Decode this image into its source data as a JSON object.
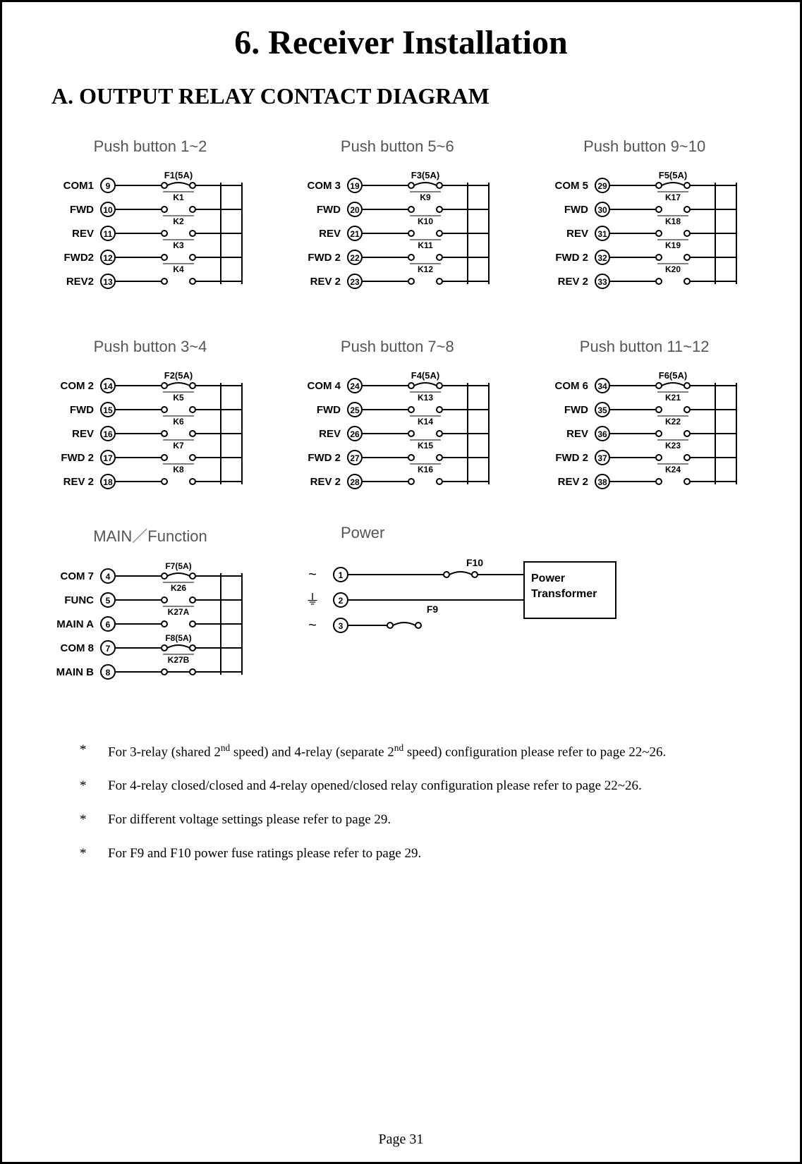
{
  "title": "6. Receiver Installation",
  "subtitle": "A. OUTPUT RELAY CONTACT DIAGRAM",
  "blocks": [
    {
      "title": "Push button 1~2",
      "fuse": "F1(5A)",
      "rows": [
        {
          "label": "COM1",
          "term": "9",
          "type": "fuse",
          "k": "K1"
        },
        {
          "label": "FWD",
          "term": "10",
          "type": "no",
          "k": "K2"
        },
        {
          "label": "REV",
          "term": "11",
          "type": "no",
          "k": "K3"
        },
        {
          "label": "FWD2",
          "term": "12",
          "type": "no",
          "k": "K4"
        },
        {
          "label": "REV2",
          "term": "13",
          "type": "no",
          "k": ""
        }
      ]
    },
    {
      "title": "Push button 5~6",
      "fuse": "F3(5A)",
      "rows": [
        {
          "label": "COM 3",
          "term": "19",
          "type": "fuse",
          "k": "K9"
        },
        {
          "label": "FWD",
          "term": "20",
          "type": "no",
          "k": "K10"
        },
        {
          "label": "REV",
          "term": "21",
          "type": "no",
          "k": "K11"
        },
        {
          "label": "FWD 2",
          "term": "22",
          "type": "no",
          "k": "K12"
        },
        {
          "label": "REV 2",
          "term": "23",
          "type": "no",
          "k": ""
        }
      ]
    },
    {
      "title": "Push button 9~10",
      "fuse": "F5(5A)",
      "rows": [
        {
          "label": "COM 5",
          "term": "29",
          "type": "fuse",
          "k": "K17"
        },
        {
          "label": "FWD",
          "term": "30",
          "type": "no",
          "k": "K18"
        },
        {
          "label": "REV",
          "term": "31",
          "type": "no",
          "k": "K19"
        },
        {
          "label": "FWD 2",
          "term": "32",
          "type": "no",
          "k": "K20"
        },
        {
          "label": "REV 2",
          "term": "33",
          "type": "no",
          "k": ""
        }
      ]
    },
    {
      "title": "Push button 3~4",
      "fuse": "F2(5A)",
      "rows": [
        {
          "label": "COM 2",
          "term": "14",
          "type": "fuse",
          "k": "K5"
        },
        {
          "label": "FWD",
          "term": "15",
          "type": "no",
          "k": "K6"
        },
        {
          "label": "REV",
          "term": "16",
          "type": "no",
          "k": "K7"
        },
        {
          "label": "FWD 2",
          "term": "17",
          "type": "no",
          "k": "K8"
        },
        {
          "label": "REV 2",
          "term": "18",
          "type": "no",
          "k": ""
        }
      ]
    },
    {
      "title": "Push button 7~8",
      "fuse": "F4(5A)",
      "rows": [
        {
          "label": "COM 4",
          "term": "24",
          "type": "fuse",
          "k": "K13"
        },
        {
          "label": "FWD",
          "term": "25",
          "type": "no",
          "k": "K14"
        },
        {
          "label": "REV",
          "term": "26",
          "type": "no",
          "k": "K15"
        },
        {
          "label": "FWD 2",
          "term": "27",
          "type": "no",
          "k": "K16"
        },
        {
          "label": "REV 2",
          "term": "28",
          "type": "no",
          "k": ""
        }
      ]
    },
    {
      "title": "Push button 11~12",
      "fuse": "F6(5A)",
      "rows": [
        {
          "label": "COM 6",
          "term": "34",
          "type": "fuse",
          "k": "K21"
        },
        {
          "label": "FWD",
          "term": "35",
          "type": "no",
          "k": "K22"
        },
        {
          "label": "REV",
          "term": "36",
          "type": "no",
          "k": "K23"
        },
        {
          "label": "FWD 2",
          "term": "37",
          "type": "no",
          "k": "K24"
        },
        {
          "label": "REV 2",
          "term": "38",
          "type": "no",
          "k": ""
        }
      ]
    }
  ],
  "mainfunc": {
    "title": "MAIN／Function",
    "rows": [
      {
        "label": "COM 7",
        "term": "4",
        "type": "fuse",
        "k": "K26",
        "toplabel": "F7(5A)"
      },
      {
        "label": "FUNC",
        "term": "5",
        "type": "no",
        "k": "K27A"
      },
      {
        "label": "MAIN A",
        "term": "6",
        "type": "no",
        "k": ""
      },
      {
        "label": "COM 8",
        "term": "7",
        "type": "fuse",
        "k": "K27B",
        "toplabel": "F8(5A)"
      },
      {
        "label": "MAIN B",
        "term": "8",
        "type": "nc",
        "k": ""
      }
    ]
  },
  "power": {
    "title": "Power",
    "box": "Power\nTransformer",
    "f10": "F10",
    "f9": "F9",
    "rows": [
      {
        "sym": "~",
        "term": "1"
      },
      {
        "sym": "⏚",
        "term": "2"
      },
      {
        "sym": "~",
        "term": "3"
      }
    ]
  },
  "notes": [
    "For 3-relay (shared 2<sup>nd</sup> speed) and 4-relay (separate 2<sup>nd</sup> speed) configuration please refer to page 22~26.",
    "For 4-relay closed/closed and 4-relay opened/closed relay configuration please refer to page 22~26.",
    "For different voltage settings please refer to page 29.",
    "For F9 and F10 power fuse ratings please refer to page 29."
  ],
  "pagefoot": "Page 31"
}
